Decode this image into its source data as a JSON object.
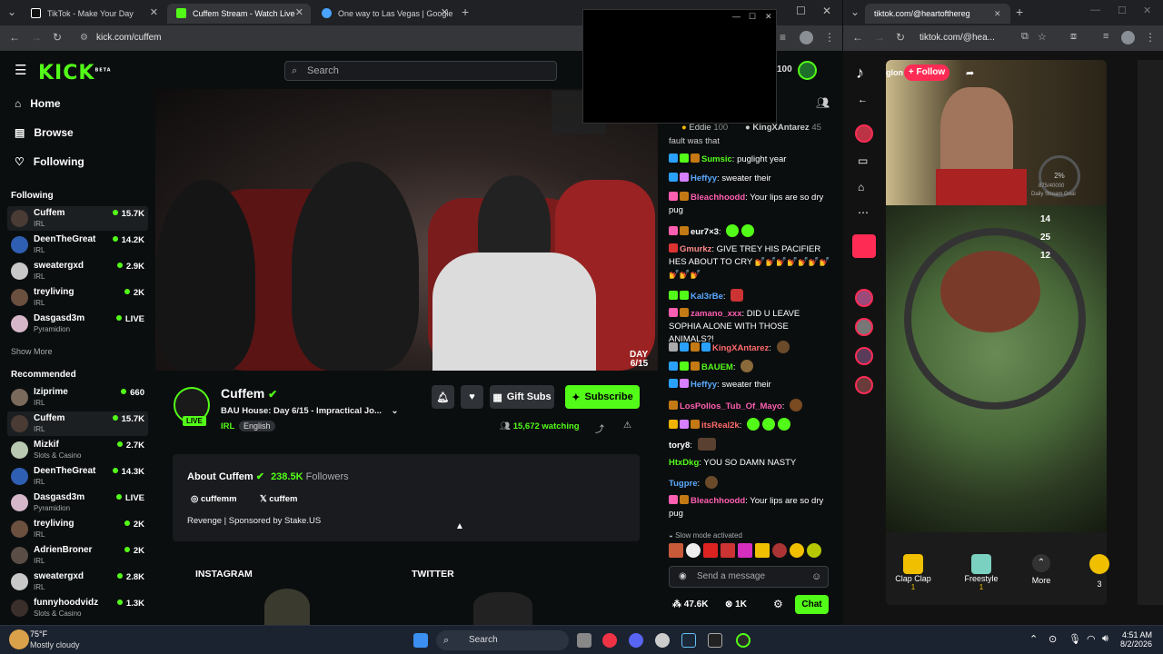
{
  "left_browser": {
    "tabs": [
      {
        "title": "TikTok - Make Your Day",
        "active": false
      },
      {
        "title": "Cuffem Stream - Watch Live",
        "active": true
      },
      {
        "title": "One way to Las Vegas | Google",
        "active": false
      }
    ],
    "url": "kick.com/cuffem"
  },
  "kick": {
    "logo": "KICK",
    "logo_beta": "BETA",
    "search_placeholder": "Search",
    "header_balance": "100",
    "nav": [
      {
        "label": "Home",
        "icon": "home-icon"
      },
      {
        "label": "Browse",
        "icon": "browse-icon"
      },
      {
        "label": "Following",
        "icon": "heart-icon"
      }
    ],
    "following_title": "Following",
    "following": [
      {
        "name": "Cuffem",
        "category": "IRL",
        "viewers": "15.7K"
      },
      {
        "name": "DeenTheGreat",
        "category": "IRL",
        "viewers": "14.2K"
      },
      {
        "name": "sweatergxd",
        "category": "IRL",
        "viewers": "2.9K"
      },
      {
        "name": "treyliving",
        "category": "IRL",
        "viewers": "2K"
      },
      {
        "name": "Dasgasd3m",
        "category": "Pyramidion",
        "viewers": "LIVE"
      }
    ],
    "show_more": "Show More",
    "recommended_title": "Recommended",
    "recommended": [
      {
        "name": "Iziprime",
        "category": "IRL",
        "viewers": "660"
      },
      {
        "name": "Cuffem",
        "category": "IRL",
        "viewers": "15.7K"
      },
      {
        "name": "Mizkif",
        "category": "Slots & Casino",
        "viewers": "2.7K"
      },
      {
        "name": "DeenTheGreat",
        "category": "IRL",
        "viewers": "14.3K"
      },
      {
        "name": "Dasgasd3m",
        "category": "Pyramidion",
        "viewers": "LIVE"
      },
      {
        "name": "treyliving",
        "category": "IRL",
        "viewers": "2K"
      },
      {
        "name": "AdrienBroner",
        "category": "IRL",
        "viewers": "2K"
      },
      {
        "name": "sweatergxd",
        "category": "IRL",
        "viewers": "2.8K"
      },
      {
        "name": "funnyhoodvidz",
        "category": "Slots & Casino",
        "viewers": "1.3K"
      }
    ],
    "video_overlay": {
      "line1": "DAY",
      "line2": "6/15"
    },
    "stream": {
      "channel": "Cuffem",
      "live_badge": "LIVE",
      "title": "BAU House: Day 6/15 - Impractical Jo...",
      "category": "IRL",
      "language": "English",
      "watching": "15,672 watching",
      "gift_subs": "Gift Subs",
      "subscribe": "Subscribe"
    },
    "about": {
      "title": "About Cuffem",
      "followers_count": "238.5K",
      "followers_label": "Followers",
      "instagram": "cuffemm",
      "twitter": "cuffem",
      "description": "Revenge | Sponsored by Stake.US"
    },
    "panels": [
      "INSTAGRAM",
      "TWITTER"
    ],
    "chat": {
      "pinned": [
        {
          "name": "Eddie",
          "amount": "100"
        },
        {
          "name": "KingXAntarez",
          "amount": "45"
        }
      ],
      "top_text": "fault was that",
      "messages": [
        {
          "user": "Sumsic",
          "color": "#53fc18",
          "text": "puglight year"
        },
        {
          "user": "Heffyy",
          "color": "#5aa9ff",
          "text": "sweater their"
        },
        {
          "user": "Bleachhoodd",
          "color": "#ff5fb1",
          "text": "Your lips are so dry pug"
        },
        {
          "user": "eur7×3",
          "color": "#ffffff",
          "text": ""
        },
        {
          "user": "Gmurkz",
          "color": "#ff8a8a",
          "text": "GIVE TREY HIS PACIFIER HES ABOUT TO CRY 💅💅💅💅💅💅💅💅💅💅"
        },
        {
          "user": "Kal3rBe",
          "color": "#5aa9ff",
          "text": ""
        },
        {
          "user": "zamano_xxx",
          "color": "#ff5fb1",
          "text": "DID U LEAVE SOPHIA ALONE WITH THOSE ANIMALS?!"
        },
        {
          "user": "KingXAntarez",
          "color": "#ff6b6b",
          "text": ""
        },
        {
          "user": "BAUEM",
          "color": "#53fc18",
          "text": ""
        },
        {
          "user": "Heffyy",
          "color": "#5aa9ff",
          "text": "sweater their"
        },
        {
          "user": "LosPollos_Tub_Of_Mayo",
          "color": "#ff5fb1",
          "text": ""
        },
        {
          "user": "itsReal2k",
          "color": "#ff6b6b",
          "text": ""
        },
        {
          "user": "tory8",
          "color": "#ffffff",
          "text": ""
        },
        {
          "user": "HtxDkg",
          "color": "#53fc18",
          "text": "YOU SO DAMN NASTY"
        },
        {
          "user": "Tugpre",
          "color": "#5aa9ff",
          "text": ""
        },
        {
          "user": "Bleachhoodd",
          "color": "#ff5fb1",
          "text": "Your lips are so dry pug"
        }
      ],
      "slow_mode": "Slow mode activated",
      "input_placeholder": "Send a message",
      "stat1": "47.6K",
      "stat2": "1K",
      "chat_button": "Chat"
    }
  },
  "right_browser": {
    "url": "tiktok.com/@heartofthereg",
    "url_short": "tiktok.com/@hea...",
    "follow_button": "+ Follow",
    "username_partial": "glon",
    "goal_pct": "2%",
    "goal_text": "875/40000",
    "goal_label": "Daily Stream Goal",
    "hud": [
      "14",
      "25",
      "12"
    ],
    "gifts": [
      {
        "name": "Clap Clap",
        "cost": "1"
      },
      {
        "name": "Freestyle",
        "cost": "1"
      }
    ],
    "more": "More",
    "coins": "3"
  },
  "taskbar": {
    "weather_temp": "75°F",
    "weather_desc": "Mostly cloudy",
    "search": "Search",
    "time": "4:51 AM",
    "date": "8/2/2026"
  }
}
